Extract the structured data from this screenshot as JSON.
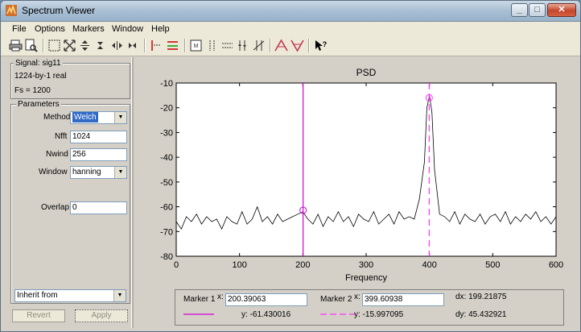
{
  "window": {
    "title": "Spectrum Viewer"
  },
  "menu": [
    "File",
    "Options",
    "Markers",
    "Window",
    "Help"
  ],
  "toolbar": {
    "icons": [
      "print-icon",
      "print-preview-icon",
      "zoom-box-icon",
      "zoom-full-icon",
      "zoom-in-y-icon",
      "zoom-out-y-icon",
      "zoom-in-x-icon",
      "zoom-out-x-icon",
      "marker-set-icon",
      "marker-line-icon",
      "marker-table-icon",
      "peak-marker-icon",
      "marker-vertical-icon",
      "marker-horizontal-icon",
      "track-marker-icon",
      "slope-marker-icon",
      "find-peak-icon",
      "find-valley-icon",
      "help-pointer-icon"
    ]
  },
  "signal": {
    "legend": "Signal: sig11",
    "size": "1224-by-1 real",
    "fs": "Fs = 1200"
  },
  "parameters": {
    "legend": "Parameters",
    "method_label": "Method",
    "method_value": "Welch",
    "nfft_label": "Nfft",
    "nfft_value": "1024",
    "nwind_label": "Nwind",
    "nwind_value": "256",
    "window_label": "Window",
    "window_value": "hanning",
    "overlap_label": "Overlap",
    "overlap_value": "0"
  },
  "inherit": {
    "value": "Inherit from"
  },
  "buttons": {
    "revert": "Revert",
    "apply": "Apply"
  },
  "chart_data": {
    "type": "line",
    "title": "PSD",
    "xlabel": "Frequency",
    "ylabel": "",
    "xlim": [
      0,
      600
    ],
    "ylim": [
      -80,
      -10
    ],
    "xticks": [
      0,
      100,
      200,
      300,
      400,
      500,
      600
    ],
    "yticks": [
      -10,
      -20,
      -30,
      -40,
      -50,
      -60,
      -70,
      -80
    ],
    "grid": false,
    "series": [
      {
        "x": [
          0,
          8,
          16,
          24,
          32,
          40,
          48,
          56,
          64,
          72,
          80,
          88,
          96,
          104,
          112,
          120,
          128,
          136,
          144,
          152,
          160,
          168,
          176,
          184,
          192,
          200,
          208,
          216,
          224,
          232,
          240,
          248,
          256,
          264,
          272,
          280,
          288,
          296,
          304,
          312,
          320,
          328,
          336,
          344,
          352,
          360,
          368,
          376,
          384,
          392,
          396,
          400,
          404,
          408,
          416,
          424,
          432,
          440,
          448,
          456,
          464,
          472,
          480,
          488,
          496,
          504,
          512,
          520,
          528,
          536,
          544,
          552,
          560,
          568,
          576,
          584,
          592,
          600
        ],
        "y": [
          -66,
          -69,
          -64,
          -66,
          -63,
          -67,
          -64,
          -66,
          -65,
          -69,
          -64,
          -66,
          -67,
          -62,
          -67,
          -65,
          -60,
          -66,
          -64,
          -67,
          -63,
          -66,
          -65,
          -64,
          -63,
          -62,
          -65,
          -67,
          -63,
          -68,
          -64,
          -66,
          -62,
          -66,
          -64,
          -68,
          -63,
          -65,
          -66,
          -62,
          -67,
          -65,
          -63,
          -67,
          -62,
          -65,
          -64,
          -65,
          -57,
          -42,
          -20,
          -15,
          -22,
          -45,
          -63,
          -64,
          -66,
          -62,
          -67,
          -63,
          -65,
          -66,
          -63,
          -67,
          -64,
          -63,
          -66,
          -62,
          -67,
          -64,
          -66,
          -63,
          -65,
          -62,
          -66,
          -64,
          -67,
          -64
        ]
      }
    ],
    "markers": [
      {
        "name": "Marker 1",
        "x": 200.39063,
        "y": -61.430016,
        "color": "#d000d0",
        "style": "solid"
      },
      {
        "name": "Marker 2",
        "x": 399.60938,
        "y": -15.997095,
        "color": "#ff33ff",
        "style": "dashed"
      }
    ]
  },
  "marker_panel": {
    "m1_label": "Marker 1",
    "m1_x_label": "x:",
    "m1_x": "200.39063",
    "m1_y": "y: -61.430016",
    "m2_label": "Marker 2",
    "m2_x_label": "x:",
    "m2_x": "399.60938",
    "m2_y": "y: -15.997095",
    "dx": "dx: 199.21875",
    "dy": "dy: 45.432921"
  },
  "colors": {
    "marker1": "#d000d0",
    "marker2": "#ff33ff",
    "line": "#000000"
  }
}
